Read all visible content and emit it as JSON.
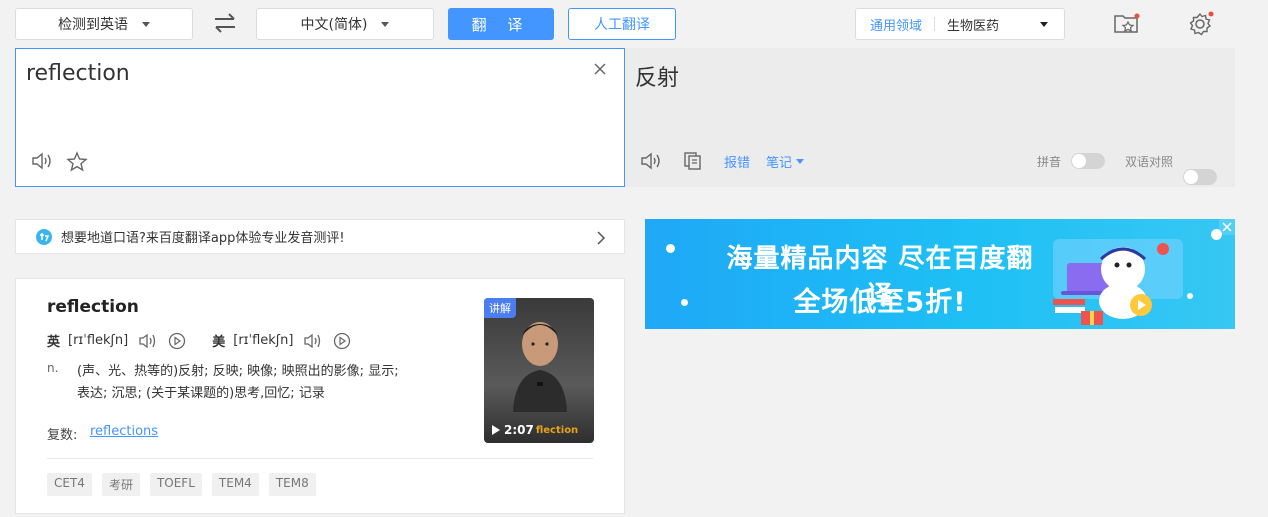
{
  "toolbar": {
    "source_lang": "检测到英语",
    "target_lang": "中文(简体)",
    "translate_label": "翻 译",
    "human_translate_label": "人工翻译",
    "domain_label": "通用领域",
    "domain_value": "生物医药"
  },
  "input": {
    "text": "reflection"
  },
  "output": {
    "text": "反射",
    "report_label": "报错",
    "notes_label": "笔记",
    "pinyin_label": "拼音",
    "bilingual_label": "双语对照"
  },
  "promo": {
    "text": "想要地道口语?来百度翻译app体验专业发音测评!"
  },
  "ad": {
    "line1": "海量精品内容 尽在百度翻译",
    "line2": "全场低至5折!"
  },
  "dict": {
    "word": "reflection",
    "uk_label": "英",
    "uk_phonetic": "[rɪˈflekʃn]",
    "us_label": "美",
    "us_phonetic": "[rɪˈflekʃn]",
    "pos": "n.",
    "def_line1": "(声、光、热等的)反射;  反映;  映像;  映照出的影像;  显示;",
    "def_line2": "表达;  沉思;  (关于某课题的)思考,回忆;  记录",
    "plural_label": "复数:",
    "plural_value": "reflections",
    "tags": [
      "CET4",
      "考研",
      "TOEFL",
      "TEM4",
      "TEM8"
    ],
    "video_badge": "讲解",
    "video_duration": "2:07",
    "video_caption": "flection"
  }
}
